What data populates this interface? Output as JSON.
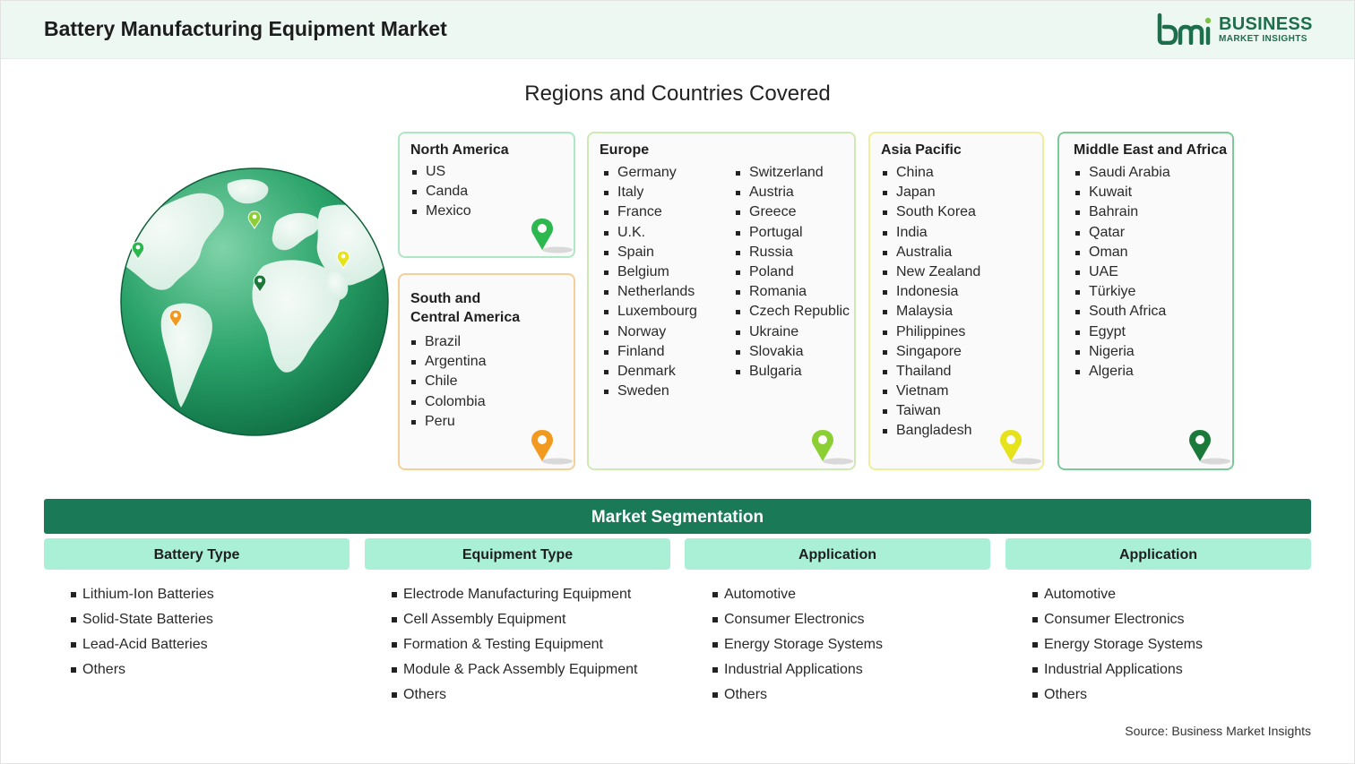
{
  "header": {
    "title": "Battery Manufacturing Equipment Market"
  },
  "logo": {
    "word1": "BUSINESS",
    "word2": "MARKET INSIGHTS"
  },
  "regions": {
    "title": "Regions and Countries Covered",
    "north_america": {
      "title": "North America",
      "items": [
        "US",
        "Canda",
        "Mexico"
      ],
      "pin_color": "#2db84f"
    },
    "south_america": {
      "title_line1": "South and",
      "title_line2": "Central America",
      "items": [
        "Brazil",
        "Argentina",
        "Chile",
        "Colombia",
        "Peru"
      ],
      "pin_color": "#f29a1f"
    },
    "europe": {
      "title": "Europe",
      "col1": [
        "Germany",
        "Italy",
        "France",
        "U.K.",
        "Spain",
        "Belgium",
        "Netherlands",
        "Luxembourg",
        "Norway",
        "Finland",
        "Denmark",
        "Sweden"
      ],
      "col2": [
        "Switzerland",
        "Austria",
        "Greece",
        "Portugal",
        "Russia",
        "Poland",
        "Romania",
        "Czech Republic",
        "Ukraine",
        "Slovakia",
        "Bulgaria"
      ],
      "pin_color": "#8ccf35"
    },
    "asia_pacific": {
      "title": "Asia Pacific",
      "items": [
        "China",
        "Japan",
        "South Korea",
        "India",
        "Australia",
        "New Zealand",
        "Indonesia",
        "Malaysia",
        "Philippines",
        "Singapore",
        "Thailand",
        "Vietnam",
        "Taiwan",
        "Bangladesh"
      ],
      "pin_color": "#e6e21c"
    },
    "mea": {
      "title": "Middle East and Africa",
      "items": [
        "Saudi Arabia",
        "Kuwait",
        "Bahrain",
        "Qatar",
        "Oman",
        "UAE",
        "Türkiye",
        "South Africa",
        "Egypt",
        "Nigeria",
        "Algeria"
      ],
      "pin_color": "#1b7a3a"
    }
  },
  "segmentation": {
    "title": "Market Segmentation",
    "columns": [
      {
        "header": "Battery Type",
        "items": [
          "Lithium-Ion Batteries",
          "Solid-State Batteries",
          "Lead-Acid Batteries",
          "Others"
        ]
      },
      {
        "header": "Equipment Type",
        "items": [
          "Electrode Manufacturing Equipment",
          "Cell Assembly Equipment",
          "Formation & Testing Equipment",
          "Module & Pack Assembly Equipment",
          "Others"
        ]
      },
      {
        "header": "Application",
        "items": [
          "Automotive",
          "Consumer Electronics",
          "Energy Storage Systems",
          "Industrial Applications",
          "Others"
        ]
      },
      {
        "header": "Application",
        "items": [
          "Automotive",
          "Consumer Electronics",
          "Energy Storage Systems",
          "Industrial Applications",
          "Others"
        ]
      }
    ]
  },
  "source": "Source: Business Market Insights",
  "colors": {
    "accent_dark": "#1a7a58",
    "accent_light": "#a9f0d6",
    "header_bg": "#eef8f3"
  }
}
